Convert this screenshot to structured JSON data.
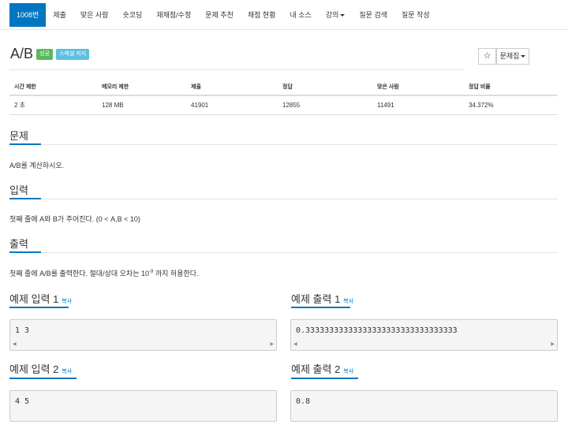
{
  "nav": {
    "items": [
      {
        "label": "1008번"
      },
      {
        "label": "제출"
      },
      {
        "label": "맞은 사람"
      },
      {
        "label": "숏코딩"
      },
      {
        "label": "재채점/수정"
      },
      {
        "label": "문제 추천"
      },
      {
        "label": "채점 현황"
      },
      {
        "label": "내 소스"
      },
      {
        "label": "강의"
      },
      {
        "label": "질문 검색"
      },
      {
        "label": "질문 작성"
      }
    ]
  },
  "problem": {
    "title": "A/B",
    "badge_success": "성공",
    "badge_special": "스페셜 저지",
    "star_icon": "☆",
    "set_button": "문제집"
  },
  "info": {
    "headers": [
      "시간 제한",
      "메모리 제한",
      "제출",
      "정답",
      "맞은 사람",
      "정답 비율"
    ],
    "values": [
      "2 초",
      "128 MB",
      "41901",
      "12855",
      "11491",
      "34.372%"
    ]
  },
  "sections": {
    "problem_head": "문제",
    "problem_text": "A/B를 계산하시오.",
    "input_head": "입력",
    "input_text": "첫째 줄에 A와 B가 주어진다. (0 < A,B < 10)",
    "output_head": "출력",
    "output_text_before": "첫째 줄에 A/B를 출력한다. 절대/상대 오차는 10",
    "output_sup": "-9",
    "output_text_after": " 까지 허용한다."
  },
  "examples": {
    "copy_label": "복사",
    "input1_head": "예제 입력 1",
    "input1_value": "1 3",
    "output1_head": "예제 출력 1",
    "output1_value": "0.33333333333333333333333333333333",
    "input2_head": "예제 입력 2",
    "input2_value": "4 5",
    "output2_head": "예제 출력 2",
    "output2_value": "0.8"
  }
}
